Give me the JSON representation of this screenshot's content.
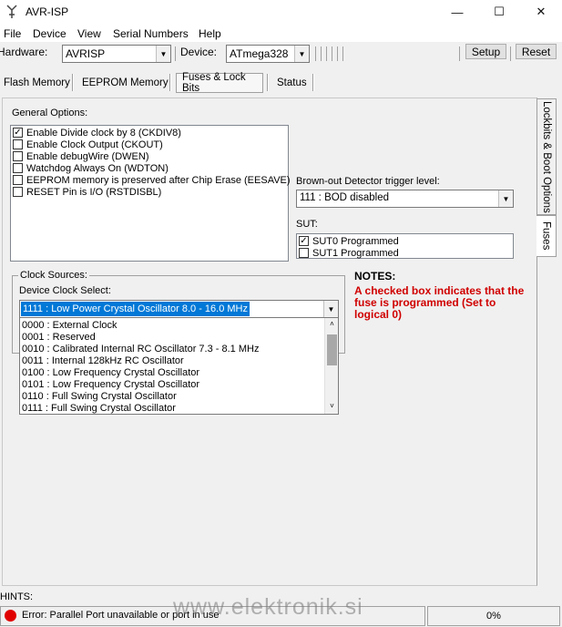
{
  "window": {
    "title": "AVR-ISP",
    "minimize": "—",
    "maximize": "☐",
    "close": "✕"
  },
  "menu": [
    "File",
    "Device",
    "View",
    "Serial Numbers",
    "Help"
  ],
  "toolbar": {
    "hardware_label": "Hardware:",
    "hardware_value": "AVRISP",
    "device_label": "Device:",
    "device_value": "ATmega328",
    "setup_label": "Setup",
    "reset_label": "Reset"
  },
  "tabs": [
    "Flash Memory",
    "EEPROM Memory",
    "Fuses & Lock Bits",
    "Status"
  ],
  "active_tab": "Fuses & Lock Bits",
  "side_tabs": [
    "Lockbits & Boot Options",
    "Fuses"
  ],
  "general_options": {
    "title": "General Options:",
    "items": [
      {
        "label": "Enable Divide clock by 8 (CKDIV8)",
        "checked": true
      },
      {
        "label": "Enable Clock Output (CKOUT)",
        "checked": false
      },
      {
        "label": "Enable debugWire (DWEN)",
        "checked": false
      },
      {
        "label": "Watchdog Always On (WDTON)",
        "checked": false
      },
      {
        "label": "EEPROM memory is preserved after Chip Erase (EESAVE)",
        "checked": false
      },
      {
        "label": "RESET Pin is I/O (RSTDISBL)",
        "checked": false
      }
    ]
  },
  "bod": {
    "label": "Brown-out Detector trigger level:",
    "value": "111 : BOD disabled"
  },
  "sut": {
    "label": "SUT:",
    "items": [
      {
        "label": "SUT0 Programmed",
        "checked": true
      },
      {
        "label": "SUT1 Programmed",
        "checked": false
      }
    ]
  },
  "clock": {
    "group_label": "Clock Sources:",
    "select_label": "Device Clock Select:",
    "selected": "1111 : Low Power Crystal Oscillator 8.0 - 16.0 MHz",
    "options": [
      "0000 : External Clock",
      "0001 : Reserved",
      "0010 : Calibrated Internal RC Oscillator 7.3 - 8.1 MHz",
      "0011 : Internal 128kHz RC Oscillator",
      "0100 : Low Frequency Crystal Oscillator",
      "0101 : Low Frequency Crystal Oscillator",
      "0110 : Full Swing Crystal Oscillator",
      "0111 : Full Swing Crystal Oscillator"
    ]
  },
  "notes": {
    "title": "NOTES:",
    "text": "A checked box indicates that the fuse is programmed (Set to logical 0)"
  },
  "hints_label": "HINTS:",
  "status": {
    "message": "Error: Parallel Port unavailable or port in use",
    "progress": "0%"
  },
  "watermark": "www.elektronik.si",
  "colors": {
    "accent": "#0078d7",
    "note": "#d00000",
    "error": "#e00000"
  }
}
